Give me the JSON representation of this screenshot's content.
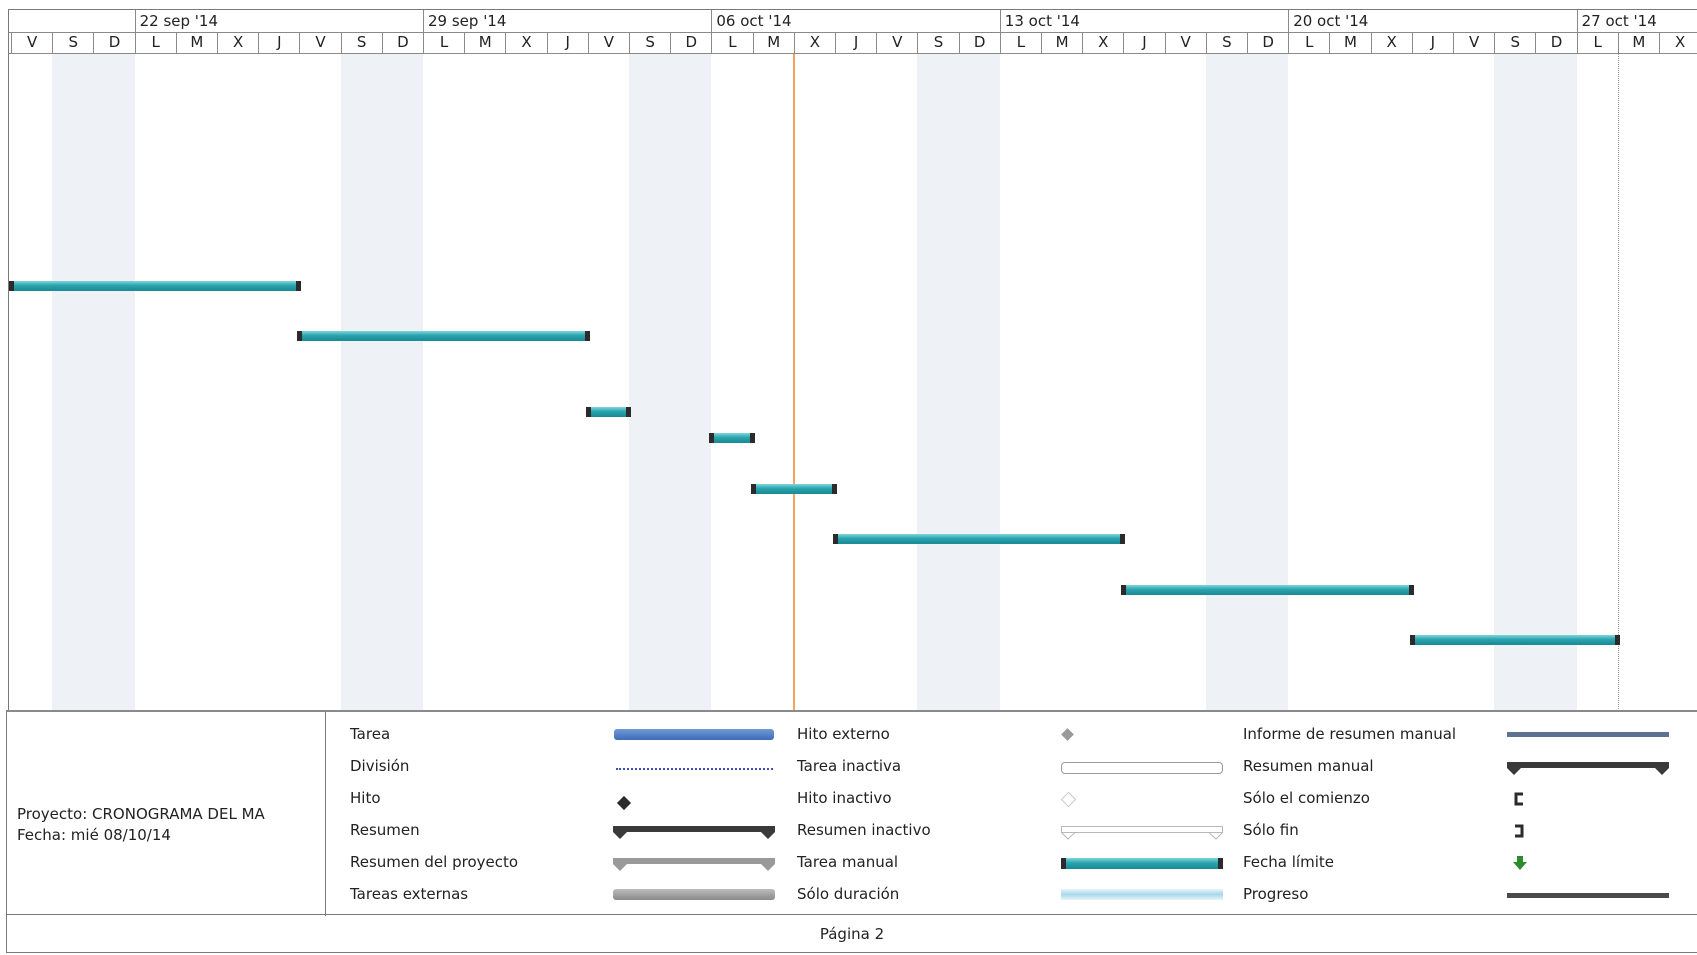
{
  "timescale": {
    "weeks": [
      "22 sep '14",
      "29 sep '14",
      "06 oct '14",
      "13 oct '14",
      "20 oct '14",
      "27 oct '14"
    ],
    "days": [
      "V",
      "S",
      "D",
      "L",
      "M",
      "X",
      "J",
      "V",
      "S",
      "D",
      "L",
      "M",
      "X",
      "J",
      "V",
      "S",
      "D",
      "L",
      "M",
      "X",
      "J",
      "V",
      "S",
      "D",
      "L",
      "M",
      "X",
      "J",
      "V",
      "S",
      "D",
      "L",
      "M",
      "X",
      "J",
      "V",
      "S",
      "D",
      "L",
      "M",
      "X"
    ]
  },
  "tasks": [
    {
      "start": 0,
      "end": 7,
      "row": 0
    },
    {
      "start": 7,
      "end": 14,
      "row": 1
    },
    {
      "start": 14,
      "end": 15,
      "row": 2
    },
    {
      "start": 17,
      "end": 18,
      "row": 3
    },
    {
      "start": 18,
      "end": 20,
      "row": 4
    },
    {
      "start": 20,
      "end": 27,
      "row": 5
    },
    {
      "start": 27,
      "end": 34,
      "row": 6
    },
    {
      "start": 34,
      "end": 39,
      "row": 7
    }
  ],
  "today_day_index": 19,
  "project": {
    "name_line": "Proyecto: CRONOGRAMA DEL MA",
    "date_line": "Fecha: mié 08/10/14"
  },
  "legend": {
    "col1": [
      "Tarea",
      "División",
      "Hito",
      "Resumen",
      "Resumen del proyecto",
      "Tareas externas"
    ],
    "col2": [
      "Hito externo",
      "Tarea inactiva",
      "Hito inactivo",
      "Resumen inactivo",
      "Tarea manual",
      "Sólo duración"
    ],
    "col3": [
      "Informe de resumen manual",
      "Resumen manual",
      "Sólo el comienzo",
      "Sólo fin",
      "Fecha límite",
      "Progreso"
    ]
  },
  "colors": {
    "task": "#3e6db5",
    "manual_task": "#2aa3ad",
    "summary": "#3a3a3a",
    "deadline": "#2e8b2e",
    "today_line": "#f4a460"
  },
  "footer": {
    "page_label": "Página 2"
  }
}
